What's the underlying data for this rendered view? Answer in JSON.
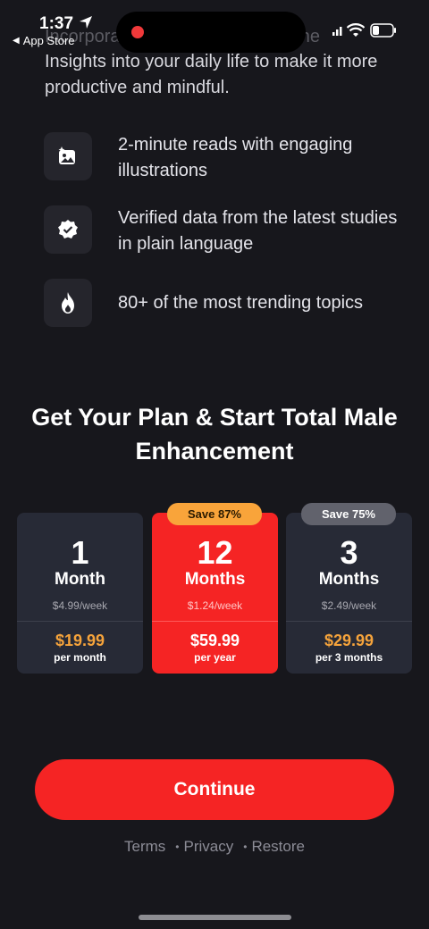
{
  "status_bar": {
    "time": "1:37",
    "back_label": "App Store"
  },
  "intro": {
    "faded_text": "Incorporate these insights from the",
    "text": "Insights into your daily life to make it more productive and mindful."
  },
  "features": [
    {
      "icon": "image-sparkle-icon",
      "text": "2-minute reads with engaging illustrations"
    },
    {
      "icon": "verified-badge-icon",
      "text": "Verified data from the latest studies in plain language"
    },
    {
      "icon": "flame-icon",
      "text": "80+ of the most trending topics"
    }
  ],
  "heading": "Get Your Plan & Start Total Male Enhancement",
  "plans": [
    {
      "count": "1",
      "unit": "Month",
      "weekly": "$4.99/week",
      "price": "$19.99",
      "period": "per month",
      "badge": "",
      "selected": false
    },
    {
      "count": "12",
      "unit": "Months",
      "weekly": "$1.24/week",
      "price": "$59.99",
      "period": "per year",
      "badge": "Save 87%",
      "selected": true
    },
    {
      "count": "3",
      "unit": "Months",
      "weekly": "$2.49/week",
      "price": "$29.99",
      "period": "per 3 months",
      "badge": "Save 75%",
      "selected": false
    }
  ],
  "continue_label": "Continue",
  "footer": {
    "terms": "Terms",
    "privacy": "Privacy",
    "restore": "Restore",
    "separator": "•"
  },
  "colors": {
    "background": "#17171c",
    "accent_red": "#f52424",
    "price_orange": "#f5a33b",
    "card": "#272a36"
  }
}
